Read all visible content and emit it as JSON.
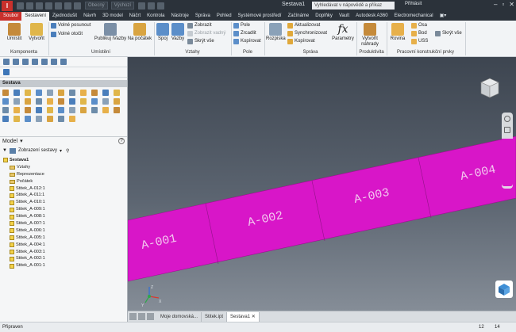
{
  "titlebar": {
    "logo": "I",
    "combo1": "Obecný",
    "combo2": "Výchozí",
    "doc_title": "Sestava1",
    "search_placeholder": "Vyhledávat v nápovědě a příkaz",
    "signin": "Přihlásit"
  },
  "tabs": [
    "Soubor",
    "Sestavení",
    "Zjednodušit",
    "Návrh",
    "3D model",
    "Náčrt",
    "Kontrola",
    "Nástroje",
    "Správa",
    "Pohled",
    "Systémové prostředí",
    "Začínáme",
    "Doplňky",
    "Vault",
    "Autodesk A360",
    "Electromechanical"
  ],
  "ribbon": {
    "umistit": "Umístit",
    "vytvorit": "Vytvořit",
    "volne_posunout": "Volné posunout",
    "volne_otocit": "Volné otočit",
    "publikuj": "Publikuj iVazby",
    "na_pocatek": "Na počátek",
    "spoj": "Spoj",
    "vazby": "Vazby",
    "zobrazit": "Zobrazit",
    "zobrazit_vadne": "Zobrazit vadný",
    "skryt_vse": "Skrýt vše",
    "pole": "Pole",
    "zrcadlit": "Zrcadlit",
    "kopirovat": "Kopírovat",
    "rozpiska": "Rozpiska",
    "aktualizovat": "Aktualizovat",
    "synchronizovat": "Synchronizovat",
    "kopirovat2": "Kopírovat",
    "parametry": "Parametry",
    "vytvorit_nahrady": "Vytvořit náhrady",
    "rovina": "Rovina",
    "osa": "Osa",
    "bod": "Bod",
    "uss": "USS",
    "skryt_vse2": "Skrýt vše",
    "groups": [
      "Komponenta",
      "Umístění",
      "Vztahy",
      "Pole",
      "Správa",
      "Produktivita",
      "Pracovní konstrukční prvky"
    ]
  },
  "browser": {
    "palette_title": "Sestava",
    "model_title": "Model",
    "view_mode": "Zobrazení sestavy",
    "help": "?",
    "tree": [
      {
        "label": "Sestava1",
        "level": 0,
        "kind": "root"
      },
      {
        "label": "Vztahy",
        "level": 1,
        "kind": "folder"
      },
      {
        "label": "Reprezentace",
        "level": 1,
        "kind": "folder"
      },
      {
        "label": "Počátek",
        "level": 1,
        "kind": "folder"
      },
      {
        "label": "Stitek_A-012:1",
        "level": 1,
        "kind": "part"
      },
      {
        "label": "Stitek_A-011:1",
        "level": 1,
        "kind": "part"
      },
      {
        "label": "Stitek_A-010:1",
        "level": 1,
        "kind": "part"
      },
      {
        "label": "Stitek_A-009:1",
        "level": 1,
        "kind": "part"
      },
      {
        "label": "Stitek_A-008:1",
        "level": 1,
        "kind": "part"
      },
      {
        "label": "Stitek_A-007:1",
        "level": 1,
        "kind": "part"
      },
      {
        "label": "Stitek_A-006:1",
        "level": 1,
        "kind": "part"
      },
      {
        "label": "Stitek_A-005:1",
        "level": 1,
        "kind": "part"
      },
      {
        "label": "Stitek_A-004:1",
        "level": 1,
        "kind": "part"
      },
      {
        "label": "Stitek_A-003:1",
        "level": 1,
        "kind": "part"
      },
      {
        "label": "Stitek_A-002:1",
        "level": 1,
        "kind": "part"
      },
      {
        "label": "Stitek_A-001:1",
        "level": 1,
        "kind": "part"
      }
    ]
  },
  "viewport": {
    "labels": [
      "A-001",
      "A-002",
      "A-003",
      "A-004"
    ],
    "band_color": "#d816c8",
    "axis_x": "X",
    "axis_y": "Y",
    "axis_z": "Z"
  },
  "doc_tabs": [
    "Moje domovská...",
    "Stitek.ipt",
    "Sestava1"
  ],
  "status": {
    "text": "Připraven",
    "count1": "12",
    "count2": "14"
  }
}
